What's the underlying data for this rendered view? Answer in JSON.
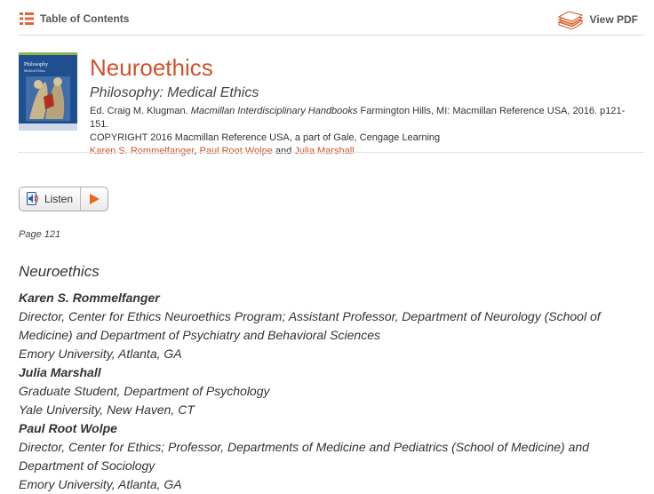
{
  "toolbar": {
    "toc_label": "Table of Contents",
    "pdf_label": "View PDF"
  },
  "article": {
    "title": "Neuroethics",
    "subtitle": "Philosophy: Medical Ethics",
    "citation_prefix": "Ed. Craig M. Klugman. ",
    "citation_series": "Macmillan Interdisciplinary Handbooks",
    "citation_suffix": " Farmington Hills, MI: Macmillan Reference USA, 2016. p121-151.",
    "copyright": "COPYRIGHT 2016 Macmillan Reference USA, a part of Gale, Cengage Learning",
    "authors": [
      "Karen S. Rommelfanger",
      "Paul Root Wolpe",
      "Julia Marshall"
    ],
    "author_sep1": ", ",
    "author_sep2": " and ",
    "cover_title": "Philosophy",
    "cover_subtitle": "Medical Ethics"
  },
  "listen": {
    "label": "Listen"
  },
  "content": {
    "page_label": "Page 121",
    "heading": "Neuroethics",
    "lines": [
      {
        "text": "Karen S. Rommelfanger",
        "bold": true
      },
      {
        "text": "Director, Center for Ethics Neuroethics Program; Assistant Professor, Department of Neurology (School of",
        "bold": false
      },
      {
        "text": "Medicine) and Department of Psychiatry and Behavioral Sciences",
        "bold": false
      },
      {
        "text": "Emory University, Atlanta, GA",
        "bold": false
      },
      {
        "text": "Julia Marshall",
        "bold": true
      },
      {
        "text": "Graduate Student, Department of Psychology",
        "bold": false
      },
      {
        "text": "Yale University, New Haven, CT",
        "bold": false
      },
      {
        "text": "Paul Root Wolpe",
        "bold": true
      },
      {
        "text": "Director, Center for Ethics; Professor, Departments of Medicine and Pediatrics (School of Medicine) and",
        "bold": false
      },
      {
        "text": "Department of Sociology",
        "bold": false
      },
      {
        "text": "Emory University, Atlanta, GA",
        "bold": false
      }
    ]
  },
  "colors": {
    "accent": "#d0532e",
    "cover": "#1f4f8f"
  }
}
